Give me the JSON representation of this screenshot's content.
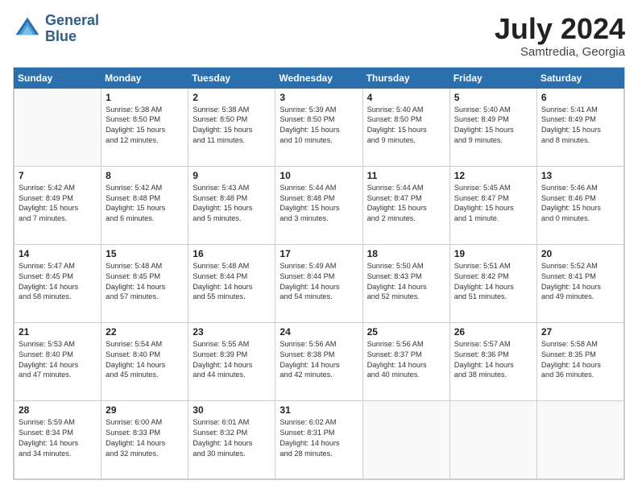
{
  "logo": {
    "line1": "General",
    "line2": "Blue"
  },
  "title": "July 2024",
  "subtitle": "Samtredia, Georgia",
  "days_of_week": [
    "Sunday",
    "Monday",
    "Tuesday",
    "Wednesday",
    "Thursday",
    "Friday",
    "Saturday"
  ],
  "weeks": [
    [
      {
        "day": "",
        "info": ""
      },
      {
        "day": "1",
        "info": "Sunrise: 5:38 AM\nSunset: 8:50 PM\nDaylight: 15 hours\nand 12 minutes."
      },
      {
        "day": "2",
        "info": "Sunrise: 5:38 AM\nSunset: 8:50 PM\nDaylight: 15 hours\nand 11 minutes."
      },
      {
        "day": "3",
        "info": "Sunrise: 5:39 AM\nSunset: 8:50 PM\nDaylight: 15 hours\nand 10 minutes."
      },
      {
        "day": "4",
        "info": "Sunrise: 5:40 AM\nSunset: 8:50 PM\nDaylight: 15 hours\nand 9 minutes."
      },
      {
        "day": "5",
        "info": "Sunrise: 5:40 AM\nSunset: 8:49 PM\nDaylight: 15 hours\nand 9 minutes."
      },
      {
        "day": "6",
        "info": "Sunrise: 5:41 AM\nSunset: 8:49 PM\nDaylight: 15 hours\nand 8 minutes."
      }
    ],
    [
      {
        "day": "7",
        "info": "Sunrise: 5:42 AM\nSunset: 8:49 PM\nDaylight: 15 hours\nand 7 minutes."
      },
      {
        "day": "8",
        "info": "Sunrise: 5:42 AM\nSunset: 8:48 PM\nDaylight: 15 hours\nand 6 minutes."
      },
      {
        "day": "9",
        "info": "Sunrise: 5:43 AM\nSunset: 8:48 PM\nDaylight: 15 hours\nand 5 minutes."
      },
      {
        "day": "10",
        "info": "Sunrise: 5:44 AM\nSunset: 8:48 PM\nDaylight: 15 hours\nand 3 minutes."
      },
      {
        "day": "11",
        "info": "Sunrise: 5:44 AM\nSunset: 8:47 PM\nDaylight: 15 hours\nand 2 minutes."
      },
      {
        "day": "12",
        "info": "Sunrise: 5:45 AM\nSunset: 8:47 PM\nDaylight: 15 hours\nand 1 minute."
      },
      {
        "day": "13",
        "info": "Sunrise: 5:46 AM\nSunset: 8:46 PM\nDaylight: 15 hours\nand 0 minutes."
      }
    ],
    [
      {
        "day": "14",
        "info": "Sunrise: 5:47 AM\nSunset: 8:45 PM\nDaylight: 14 hours\nand 58 minutes."
      },
      {
        "day": "15",
        "info": "Sunrise: 5:48 AM\nSunset: 8:45 PM\nDaylight: 14 hours\nand 57 minutes."
      },
      {
        "day": "16",
        "info": "Sunrise: 5:48 AM\nSunset: 8:44 PM\nDaylight: 14 hours\nand 55 minutes."
      },
      {
        "day": "17",
        "info": "Sunrise: 5:49 AM\nSunset: 8:44 PM\nDaylight: 14 hours\nand 54 minutes."
      },
      {
        "day": "18",
        "info": "Sunrise: 5:50 AM\nSunset: 8:43 PM\nDaylight: 14 hours\nand 52 minutes."
      },
      {
        "day": "19",
        "info": "Sunrise: 5:51 AM\nSunset: 8:42 PM\nDaylight: 14 hours\nand 51 minutes."
      },
      {
        "day": "20",
        "info": "Sunrise: 5:52 AM\nSunset: 8:41 PM\nDaylight: 14 hours\nand 49 minutes."
      }
    ],
    [
      {
        "day": "21",
        "info": "Sunrise: 5:53 AM\nSunset: 8:40 PM\nDaylight: 14 hours\nand 47 minutes."
      },
      {
        "day": "22",
        "info": "Sunrise: 5:54 AM\nSunset: 8:40 PM\nDaylight: 14 hours\nand 45 minutes."
      },
      {
        "day": "23",
        "info": "Sunrise: 5:55 AM\nSunset: 8:39 PM\nDaylight: 14 hours\nand 44 minutes."
      },
      {
        "day": "24",
        "info": "Sunrise: 5:56 AM\nSunset: 8:38 PM\nDaylight: 14 hours\nand 42 minutes."
      },
      {
        "day": "25",
        "info": "Sunrise: 5:56 AM\nSunset: 8:37 PM\nDaylight: 14 hours\nand 40 minutes."
      },
      {
        "day": "26",
        "info": "Sunrise: 5:57 AM\nSunset: 8:36 PM\nDaylight: 14 hours\nand 38 minutes."
      },
      {
        "day": "27",
        "info": "Sunrise: 5:58 AM\nSunset: 8:35 PM\nDaylight: 14 hours\nand 36 minutes."
      }
    ],
    [
      {
        "day": "28",
        "info": "Sunrise: 5:59 AM\nSunset: 8:34 PM\nDaylight: 14 hours\nand 34 minutes."
      },
      {
        "day": "29",
        "info": "Sunrise: 6:00 AM\nSunset: 8:33 PM\nDaylight: 14 hours\nand 32 minutes."
      },
      {
        "day": "30",
        "info": "Sunrise: 6:01 AM\nSunset: 8:32 PM\nDaylight: 14 hours\nand 30 minutes."
      },
      {
        "day": "31",
        "info": "Sunrise: 6:02 AM\nSunset: 8:31 PM\nDaylight: 14 hours\nand 28 minutes."
      },
      {
        "day": "",
        "info": ""
      },
      {
        "day": "",
        "info": ""
      },
      {
        "day": "",
        "info": ""
      }
    ]
  ]
}
